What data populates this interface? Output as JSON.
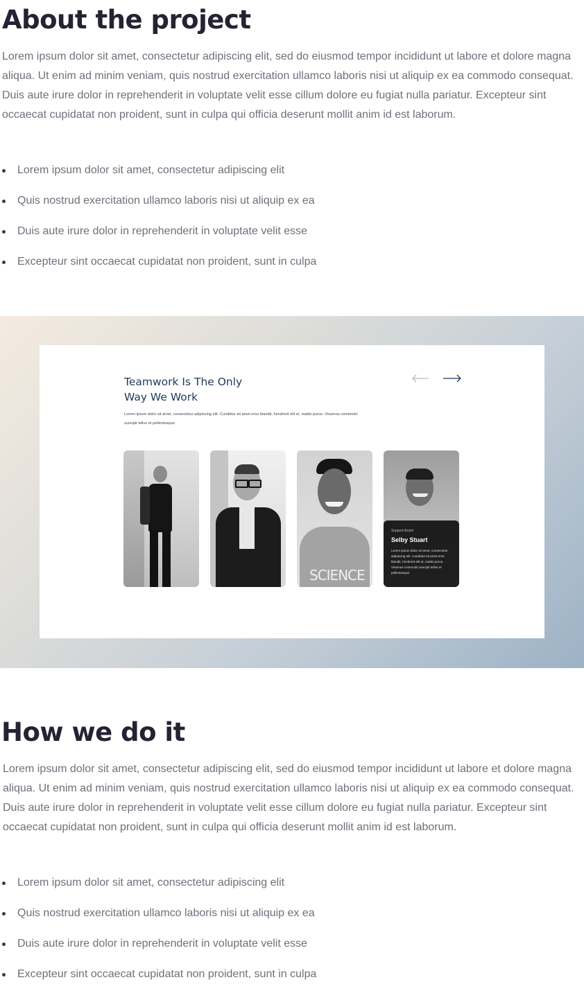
{
  "about": {
    "title": "About the project",
    "paragraph": "Lorem ipsum dolor sit amet, consectetur adipiscing elit, sed do eiusmod tempor incididunt ut labore et dolore magna aliqua. Ut enim ad minim veniam, quis nostrud exercitation ullamco laboris nisi ut aliquip ex ea commodo consequat. Duis aute irure dolor in reprehenderit in voluptate velit esse cillum dolore eu fugiat nulla pariatur. Excepteur sint occaecat cupidatat non proident, sunt in culpa qui officia deserunt mollit anim id est laborum.",
    "bullets": [
      "Lorem ipsum dolor sit amet, consectetur adipiscing elit",
      "Quis nostrud exercitation ullamco laboris nisi ut aliquip ex ea",
      "Duis aute irure dolor in reprehenderit in voluptate velit esse",
      "Excepteur sint occaecat cupidatat non proident, sunt in culpa"
    ]
  },
  "showcase": {
    "title_line1": "Teamwork Is The Only",
    "title_line2": "Way We Work",
    "text": "Lorem ipsum dolor sit amet, consectetur adipiscing elit. Curabitur sit amet eros blandit, hendrerit elit et, mattis purus. Vivamus commodo suscipit tellus et pellentesque.",
    "prev_arrow": "⟵",
    "next_arrow": "⟶",
    "featured_member": {
      "role": "Support Assist",
      "name": "Selby Stuart",
      "bio": "Lorem ipsum dolor sit amet, consectetur adipiscing elit. Curabitur sit amet eros blandit, hendrerit elit et, mattis purus. Vivamus commodo suscipit tellus et pellentesque."
    }
  },
  "how": {
    "title": "How we do it",
    "paragraph": "Lorem ipsum dolor sit amet, consectetur adipiscing elit, sed do eiusmod tempor incididunt ut labore et dolore magna aliqua. Ut enim ad minim veniam, quis nostrud exercitation ullamco laboris nisi ut aliquip ex ea commodo consequat. Duis aute irure dolor in reprehenderit in voluptate velit esse cillum dolore eu fugiat nulla pariatur. Excepteur sint occaecat cupidatat non proident, sunt in culpa qui officia deserunt mollit anim id est laborum.",
    "bullets": [
      "Lorem ipsum dolor sit amet, consectetur adipiscing elit",
      "Quis nostrud exercitation ullamco laboris nisi ut aliquip ex ea",
      "Duis aute irure dolor in reprehenderit in voluptate velit esse",
      "Excepteur sint occaecat cupidatat non proident, sunt in culpa"
    ]
  }
}
